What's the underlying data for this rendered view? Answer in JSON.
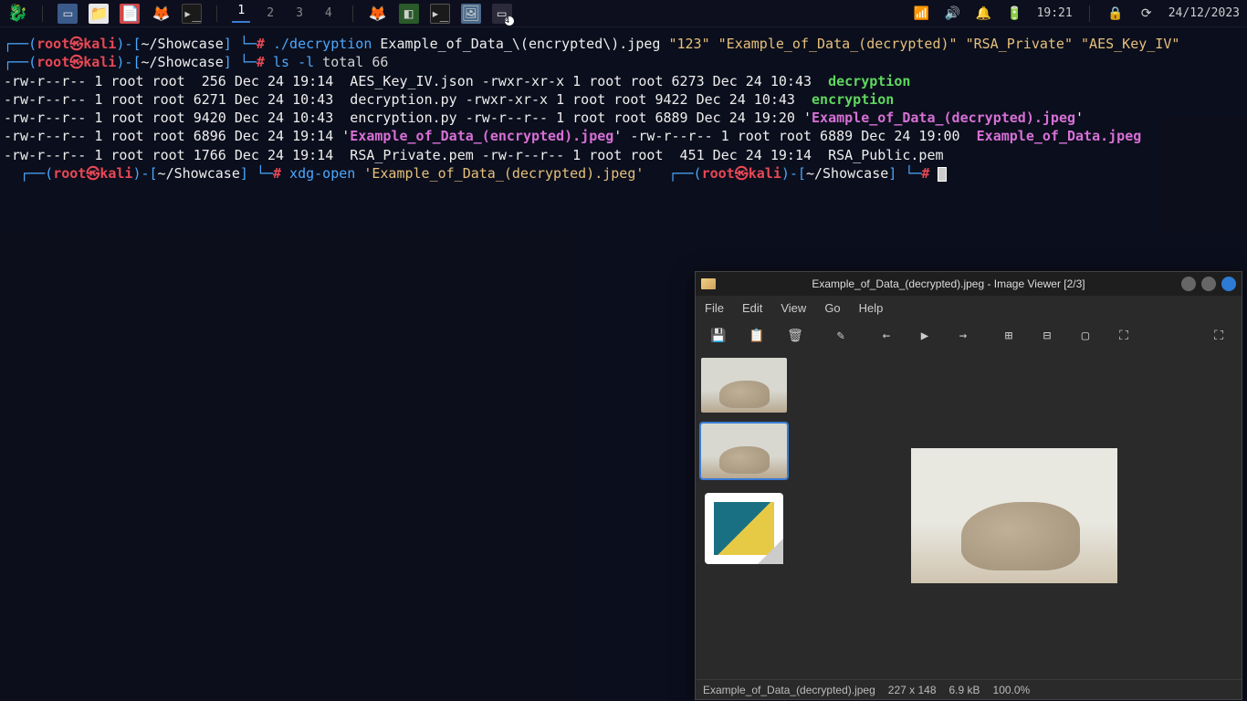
{
  "taskbar": {
    "workspaces": [
      "1",
      "2",
      "3",
      "4"
    ],
    "active_workspace": 0,
    "time": "19:21",
    "date": "24/12/2023"
  },
  "terminal": {
    "prompt": {
      "open_paren": "┌──(",
      "user": "root",
      "at": "㉿",
      "host": "kali",
      "close_paren": ")-",
      "path_open": "[",
      "path": "~/Showcase",
      "path_close": "]",
      "line2_prefix": "└─",
      "hash": "#"
    },
    "cmd1": {
      "exe": " ./decryption ",
      "arg1": "Example_of_Data_\\(encrypted\\).jpeg ",
      "arg2_q": "\"123\"",
      "space1": " ",
      "arg3_q": "\"Example_of_Data_(decrypted)\"",
      "space2": " ",
      "arg4_q": "\"RSA_Private\"",
      "space3": " ",
      "arg5_q": "\"AES_Key_IV\""
    },
    "cmd2": " ls -l",
    "ls_total": "total 66",
    "ls_rows": [
      {
        "perm": "-rw-r--r-- 1 root root  256 Dec 24 19:14  ",
        "name": "AES_Key_IV.json",
        "cls": "p-white"
      },
      {
        "perm": "-rwxr-xr-x 1 root root 6273 Dec 24 10:43  ",
        "name": "decryption",
        "cls": "p-green"
      },
      {
        "perm": "-rw-r--r-- 1 root root 6271 Dec 24 10:43  ",
        "name": "decryption.py",
        "cls": "p-white"
      },
      {
        "perm": "-rwxr-xr-x 1 root root 9422 Dec 24 10:43  ",
        "name": "encryption",
        "cls": "p-green"
      },
      {
        "perm": "-rw-r--r-- 1 root root 9420 Dec 24 10:43  ",
        "name": "encryption.py",
        "cls": "p-white"
      },
      {
        "perm": "-rw-r--r-- 1 root root 6889 Dec 24 19:20 ",
        "quote": "'",
        "name": "Example_of_Data_(decrypted).jpeg",
        "cls": "p-magenta"
      },
      {
        "perm": "-rw-r--r-- 1 root root 6896 Dec 24 19:14 ",
        "quote": "'",
        "name": "Example_of_Data_(encrypted).jpeg",
        "cls": "p-magenta"
      },
      {
        "perm": "-rw-r--r-- 1 root root 6889 Dec 24 19:00  ",
        "name": "Example_of_Data.jpeg",
        "cls": "p-magenta"
      },
      {
        "perm": "-rw-r--r-- 1 root root 1766 Dec 24 19:14  ",
        "name": "RSA_Private.pem",
        "cls": "p-white"
      },
      {
        "perm": "-rw-r--r-- 1 root root  451 Dec 24 19:14  ",
        "name": "RSA_Public.pem",
        "cls": "p-white"
      }
    ],
    "cmd3_exe": " xdg-open ",
    "cmd3_arg": "'Example_of_Data_(decrypted).jpeg'"
  },
  "viewer": {
    "title": "Example_of_Data_(decrypted).jpeg - Image Viewer [2/3]",
    "menus": [
      "File",
      "Edit",
      "View",
      "Go",
      "Help"
    ],
    "status_file": "Example_of_Data_(decrypted).jpeg",
    "status_dims": "227 x 148",
    "status_size": "6.9 kB",
    "status_zoom": "100.0%"
  }
}
